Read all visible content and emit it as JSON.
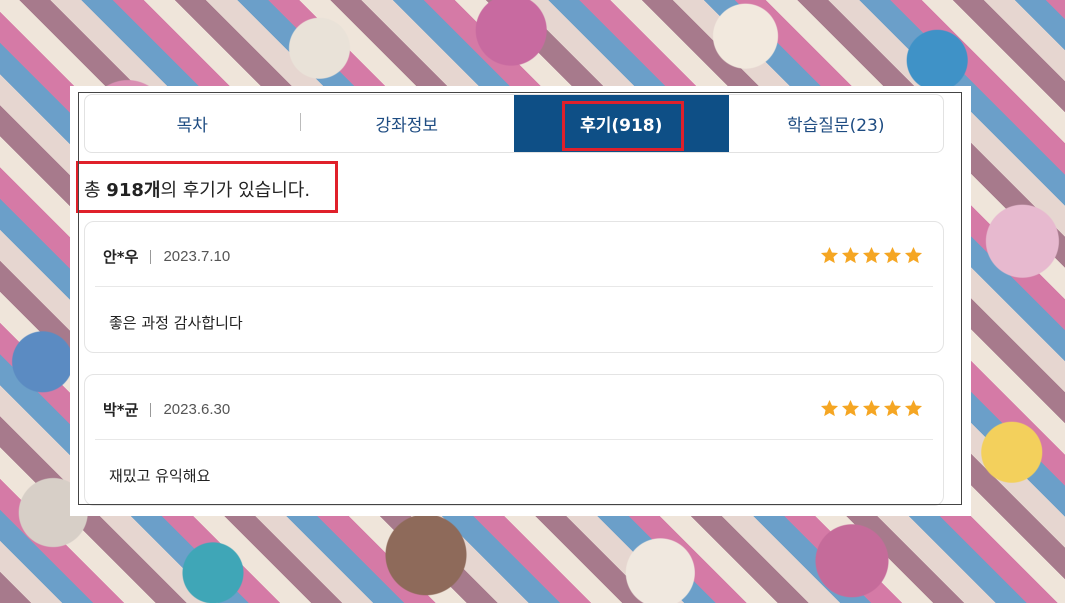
{
  "tabs": [
    {
      "label": "목차"
    },
    {
      "label": "강좌정보"
    },
    {
      "label": "후기(918)"
    },
    {
      "label": "학습질문(23)"
    }
  ],
  "summary": {
    "prefix": "총 ",
    "count": "918개",
    "suffix": "의 후기가 있습니다."
  },
  "reviews": [
    {
      "name": "안*우",
      "date": "2023.7.10",
      "rating": 5,
      "text": "좋은 과정 감사합니다"
    },
    {
      "name": "박*균",
      "date": "2023.6.30",
      "rating": 5,
      "text": "재밌고 유익해요"
    }
  ],
  "colors": {
    "active_tab": "#0e4f86",
    "tab_text": "#1e4c82",
    "star": "#f5a623",
    "highlight": "#e0202a"
  }
}
